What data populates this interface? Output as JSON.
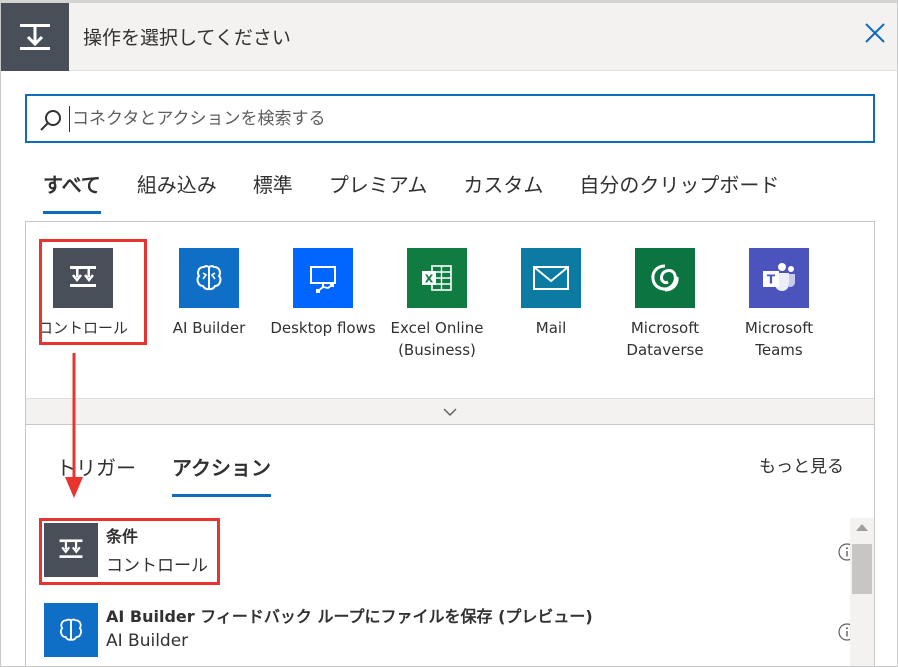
{
  "header": {
    "title": "操作を選択してください"
  },
  "search": {
    "placeholder": "コネクタとアクションを検索する"
  },
  "tabs": [
    {
      "label": "すべて",
      "active": true
    },
    {
      "label": "組み込み"
    },
    {
      "label": "標準"
    },
    {
      "label": "プレミアム"
    },
    {
      "label": "カスタム"
    },
    {
      "label": "自分のクリップボード"
    }
  ],
  "connectors": [
    {
      "label": "コントロール",
      "icon": "control-icon",
      "color": "#484f58"
    },
    {
      "label": "AI Builder",
      "icon": "ai-builder-icon",
      "color": "#0f6fc6"
    },
    {
      "label": "Desktop flows",
      "icon": "desktop-flows-icon",
      "color": "#0066ff"
    },
    {
      "label": "Excel Online (Business)",
      "icon": "excel-icon",
      "color": "#107c41"
    },
    {
      "label": "Mail",
      "icon": "mail-icon",
      "color": "#0c7ba4"
    },
    {
      "label": "Microsoft Dataverse",
      "icon": "dataverse-icon",
      "color": "#0b7440"
    },
    {
      "label": "Microsoft Teams",
      "icon": "teams-icon",
      "color": "#4b53bc"
    }
  ],
  "subtabs": [
    {
      "label": "トリガー"
    },
    {
      "label": "アクション",
      "active": true
    }
  ],
  "see_more": "もっと見る",
  "actions": [
    {
      "name": "条件",
      "connector": "コントロール",
      "icon": "control-icon",
      "color": "#484f58"
    },
    {
      "name": "AI Builder フィードバック ループにファイルを保存 (プレビュー)",
      "connector": "AI Builder",
      "icon": "ai-builder-icon",
      "color": "#0f6fc6"
    }
  ],
  "colors": {
    "accent": "#0f6cbd",
    "highlight": "#e8332e"
  }
}
